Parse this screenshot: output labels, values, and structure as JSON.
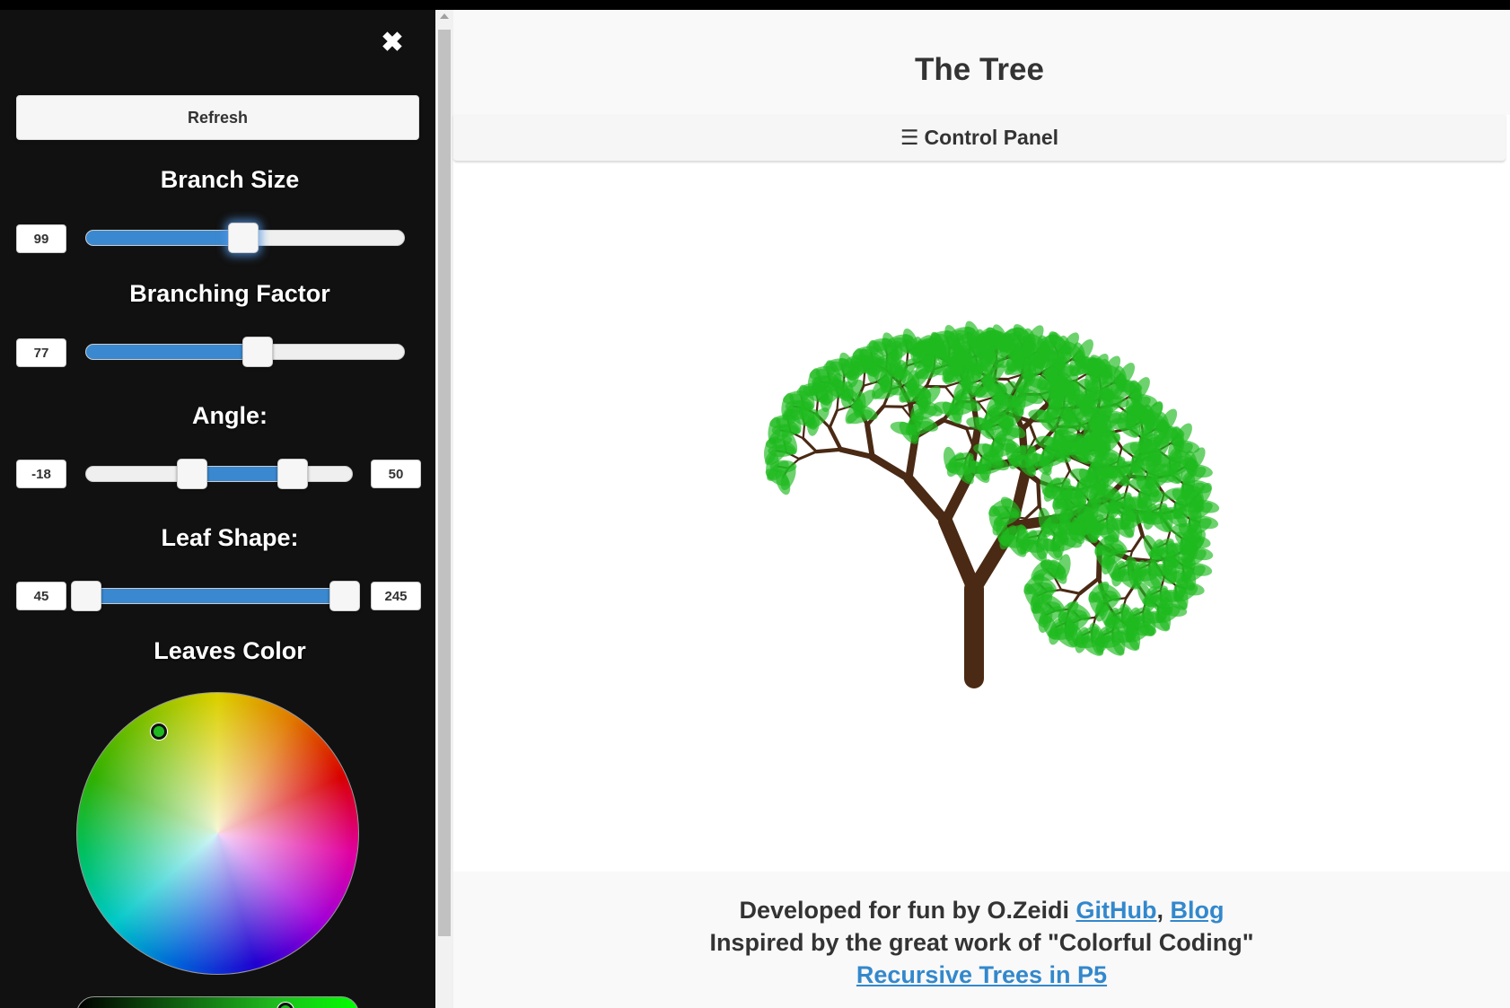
{
  "panel": {
    "refresh_label": "Refresh",
    "close_icon": "close-icon",
    "branch_size": {
      "title": "Branch Size",
      "value": "99",
      "fraction": 0.5
    },
    "branching_factor": {
      "title": "Branching Factor",
      "value": "77",
      "fraction": 0.54
    },
    "angle": {
      "title": "Angle:",
      "min_value": "-18",
      "max_value": "50"
    },
    "leaf_shape": {
      "title": "Leaf Shape:",
      "min_value": "45",
      "max_value": "245"
    },
    "leaves_color": {
      "title": "Leaves Color",
      "selected_color": "#1fba1f"
    }
  },
  "header": {
    "title": "The Tree",
    "control_panel_label": "Control Panel",
    "menu_icon": "☰"
  },
  "footer": {
    "line1_prefix": "Developed for fun by O.Zeidi ",
    "github_link": "GitHub",
    "separator": ", ",
    "blog_link": "Blog",
    "line2": "Inspired by the great work of \"Colorful Coding\"",
    "recursive_link": "Recursive Trees in P5"
  },
  "colors": {
    "panel_bg": "#111111",
    "accent": "#3a88d0",
    "trunk": "#4a2a14",
    "leaves": "#1fba1f",
    "link": "#3388cc"
  }
}
